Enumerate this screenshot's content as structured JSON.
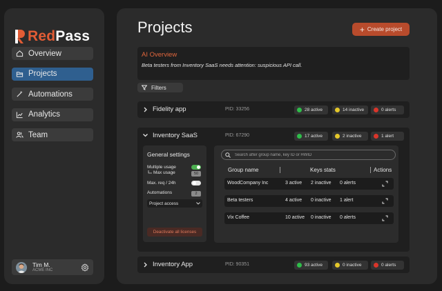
{
  "brand": {
    "prefix": "Red",
    "suffix": "Pass"
  },
  "nav": {
    "items": [
      {
        "label": "Overview",
        "icon": "home-icon"
      },
      {
        "label": "Projects",
        "icon": "folder-icon",
        "active": true
      },
      {
        "label": "Automations",
        "icon": "magic-wand-icon"
      },
      {
        "label": "Analytics",
        "icon": "line-chart-icon"
      },
      {
        "label": "Team",
        "icon": "users-icon"
      }
    ]
  },
  "user": {
    "name": "Tim M.",
    "org": "ACME INC"
  },
  "page": {
    "title": "Projects",
    "create_label": "Create project"
  },
  "ai_overview": {
    "title": "AI Overview",
    "message": "Beta testers from Inventory SaaS needs attention: suspicious API call."
  },
  "filters_label": "Filters",
  "projects": [
    {
      "name": "Fidelity app",
      "pid": "PID: 33256",
      "active": "28 active",
      "inactive": "14 inactive",
      "alerts": "0 alerts",
      "expanded": false
    },
    {
      "name": "Inventory SaaS",
      "pid": "PID: 67290",
      "active": "17 active",
      "inactive": "2 inactive",
      "alerts": "1 alert",
      "expanded": true
    },
    {
      "name": "Inventory App",
      "pid": "PID: 90351",
      "active": "93 active",
      "inactive": "0 inactive",
      "alerts": "0 alerts",
      "expanded": false
    }
  ],
  "settings": {
    "title": "General settings",
    "multiple_usage": "Multiple usage",
    "max_usage": "Max usage",
    "max_usage_value": "50",
    "max_req": "Max. req / 24h",
    "automations": "Automations",
    "automations_value": "2",
    "project_access": "Project access",
    "deactivate_label": "Deactivate all licenses"
  },
  "groups": {
    "search_placeholder": "Search after group name, key ID or HWID",
    "columns": {
      "name": "Group name",
      "keys": "Keys stats",
      "actions": "Actions"
    },
    "rows": [
      {
        "name": "WoodCompany Inc",
        "active": "3 active",
        "inactive": "2 inactive",
        "alerts": "0 alerts"
      },
      {
        "name": "Beta testers",
        "active": "4 active",
        "inactive": "0 inactive",
        "alerts": "1 alert"
      },
      {
        "name": "Vix Coffee",
        "active": "10 active",
        "inactive": "0 inactive",
        "alerts": "0 alerts"
      }
    ]
  },
  "colors": {
    "accent": "#e25c35",
    "active_nav": "#2f5f8f",
    "status_active": "#2fbd4a",
    "status_inactive": "#e4c72a",
    "status_alert": "#d9352a",
    "toggle_on": "#4caf50"
  }
}
